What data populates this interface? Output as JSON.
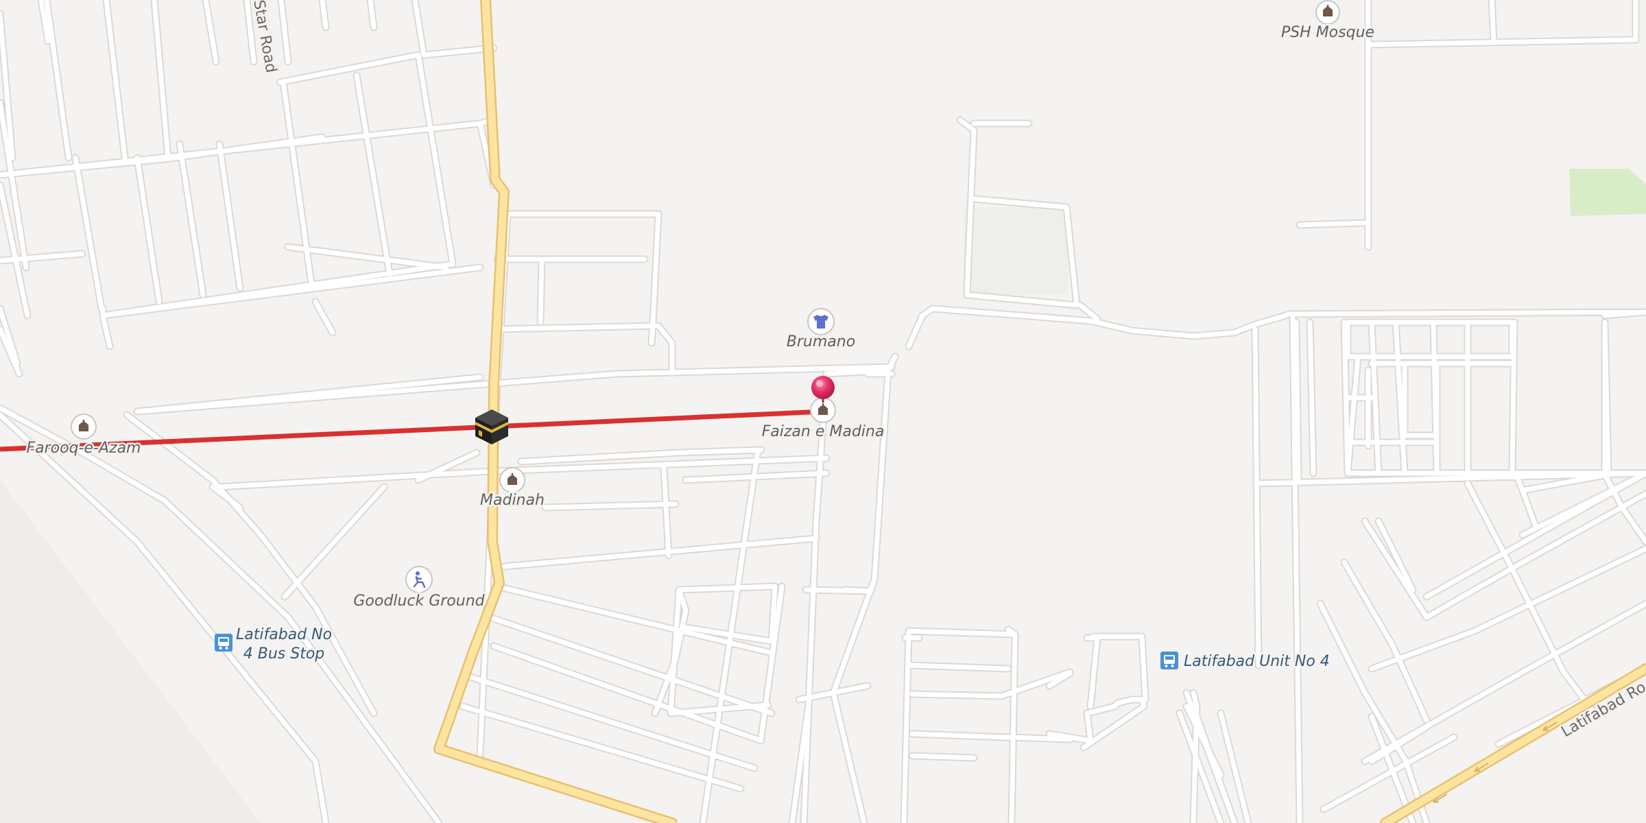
{
  "map": {
    "streets": {
      "star_road": "Star Road",
      "latifabad_road": "Latifabad Ro"
    },
    "places": {
      "psh_mosque": "PSH Mosque",
      "brumano": "Brumano",
      "faizan_e_madina": "Faizan e Madina",
      "farooq_e_azam": "Farooq-e-Azam",
      "madinah": "Madinah",
      "goodluck_ground": "Goodluck Ground"
    },
    "transit": {
      "bus_stop_line1": "Latifabad No",
      "bus_stop_line2": "4 Bus Stop",
      "latifabad_unit": "Latifabad Unit No 4"
    },
    "icons": {
      "mosque": "mosque-icon",
      "clothing_store": "shirt-icon",
      "sports": "sports-icon",
      "bus": "bus-stop-icon",
      "kaaba": "kaaba-icon",
      "marker": "location-pin-icon"
    },
    "colors": {
      "background": "#f5f3f1",
      "minor_road": "#ffffff",
      "main_road": "#fde4a0",
      "route_line": "#d93030",
      "marker": "#e8306a",
      "bus_icon": "#4a90d9",
      "park": "#d8ecc8"
    }
  }
}
